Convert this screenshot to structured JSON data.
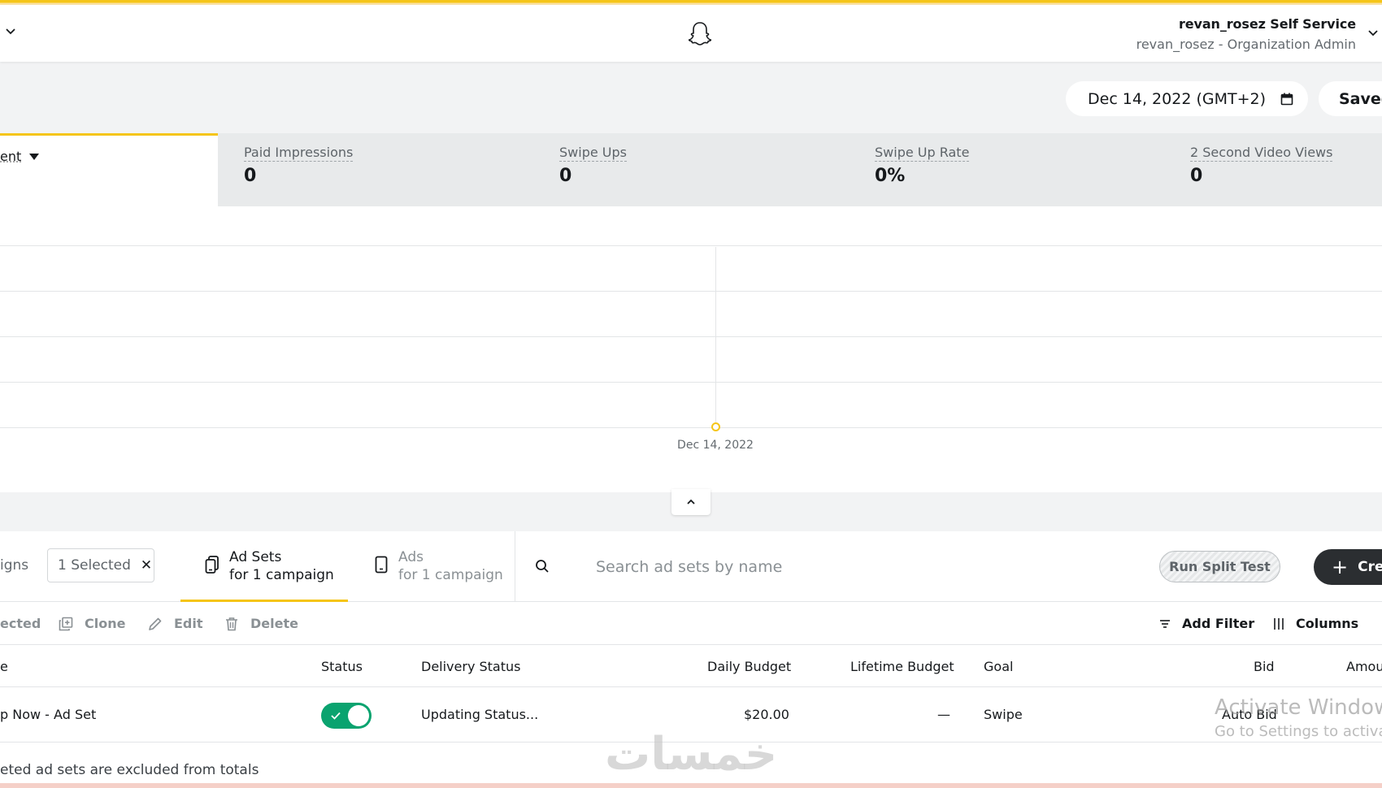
{
  "header": {
    "account_name": "revan_rosez Self Service",
    "account_role": "revan_rosez - Organization Admin"
  },
  "date_picker": {
    "label": "Dec 14, 2022 (GMT+2)"
  },
  "saved_button": {
    "label": "Saved"
  },
  "metrics": {
    "first": {
      "label": "ent"
    },
    "items": [
      {
        "label": "Paid Impressions",
        "value": "0"
      },
      {
        "label": "Swipe Ups",
        "value": "0"
      },
      {
        "label": "Swipe Up Rate",
        "value": "0%"
      },
      {
        "label": "2 Second Video Views",
        "value": "0"
      }
    ]
  },
  "chart": {
    "x_label": "Dec 14, 2022"
  },
  "tabs": {
    "campaigns_label": "igns",
    "selected_chip": "1 Selected",
    "ad_sets": {
      "title": "Ad Sets",
      "subtitle": "for 1 campaign"
    },
    "ads": {
      "title": "Ads",
      "subtitle": "for 1 campaign"
    }
  },
  "search": {
    "placeholder": "Search ad sets by name"
  },
  "buttons": {
    "split_test": "Run Split Test",
    "create": "Cre"
  },
  "toolbar": {
    "selected": "ected",
    "clone": "Clone",
    "edit": "Edit",
    "delete": "Delete",
    "add_filter": "Add Filter",
    "columns": "Columns"
  },
  "table": {
    "headers": {
      "name": "e",
      "status": "Status",
      "delivery": "Delivery Status",
      "daily_budget": "Daily Budget",
      "lifetime_budget": "Lifetime Budget",
      "goal": "Goal",
      "bid": "Bid",
      "amount": "Amou"
    },
    "row": {
      "name": "p Now - Ad Set",
      "status_on": true,
      "delivery": "Updating Status...",
      "daily_budget": "$20.00",
      "lifetime_budget": "—",
      "goal": "Swipe",
      "bid": "Auto Bid"
    }
  },
  "footer_note": "eted ad sets are excluded from totals",
  "overlay": {
    "windows_title": "Activate Windows",
    "windows_subtitle": "Go to Settings to activat",
    "arabic_watermark": "خمسات"
  },
  "colors": {
    "accent_yellow": "#f5c518",
    "toggle_green": "#0aa36f",
    "create_dark": "#2b2e31"
  }
}
